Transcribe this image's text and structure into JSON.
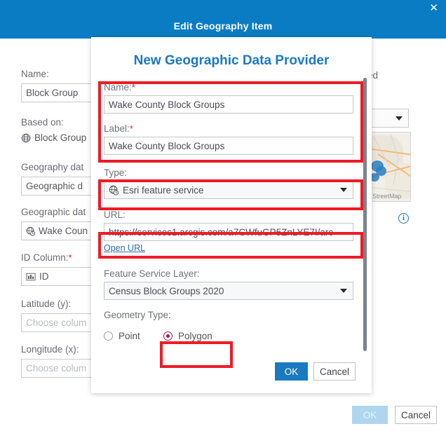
{
  "window": {
    "title": "Edit Geography Item",
    "close_icon": "close-icon",
    "ok_label": "OK",
    "cancel_label": "Cancel"
  },
  "background_form": {
    "name_label": "Name:",
    "name_value": "Block Group",
    "based_on_label": "Based on:",
    "based_on_value": "Block Group",
    "based_on_icon": "globe-icon",
    "geography_data_label": "Geography dat",
    "geography_data_value": "Geographic d",
    "geography_data_provider_label": "Geographic dat",
    "geography_data_provider_value": "Wake Coun",
    "geography_data_provider_icon": "esri-feature-service-icon",
    "id_column_label": "ID Column:",
    "id_column_required": "*",
    "id_column_value": "ID",
    "id_column_icon": "column-icon",
    "latitude_label": "Latitude (y):",
    "latitude_placeholder": "Choose colum",
    "longitude_label": "Longitude (x):",
    "longitude_placeholder": "Choose colum",
    "right_truncated_label": "ed",
    "map_attribution": "StreetMap",
    "info_icon": "info-icon"
  },
  "modal": {
    "title": "New Geographic Data Provider",
    "name_label": "Name:",
    "name_required": "*",
    "name_value": "Wake County Block Groups",
    "label_label": "Label:",
    "label_required": "*",
    "label_value": "Wake County Block Groups",
    "type_label": "Type:",
    "type_value": "Esri feature service",
    "type_icon": "esri-feature-service-icon",
    "url_label": "URL:",
    "url_value": "https://services1.arcgis.com/a7CWfuGP5ZnLYE7I/arc",
    "open_url_link": "Open URL",
    "feature_service_layer_label": "Feature Service Layer:",
    "feature_service_layer_value": "Census Block Groups 2020",
    "geometry_type_label": "Geometry Type:",
    "geometry_point_label": "Point",
    "geometry_polygon_label": "Polygon",
    "geometry_selected": "Polygon",
    "ok_label": "OK",
    "cancel_label": "Cancel"
  },
  "colors": {
    "header_blue": "#0a7cc4",
    "title_blue": "#1b79c0",
    "annotation_red": "#ed1c24",
    "radio_selected": "#8c1a54"
  }
}
